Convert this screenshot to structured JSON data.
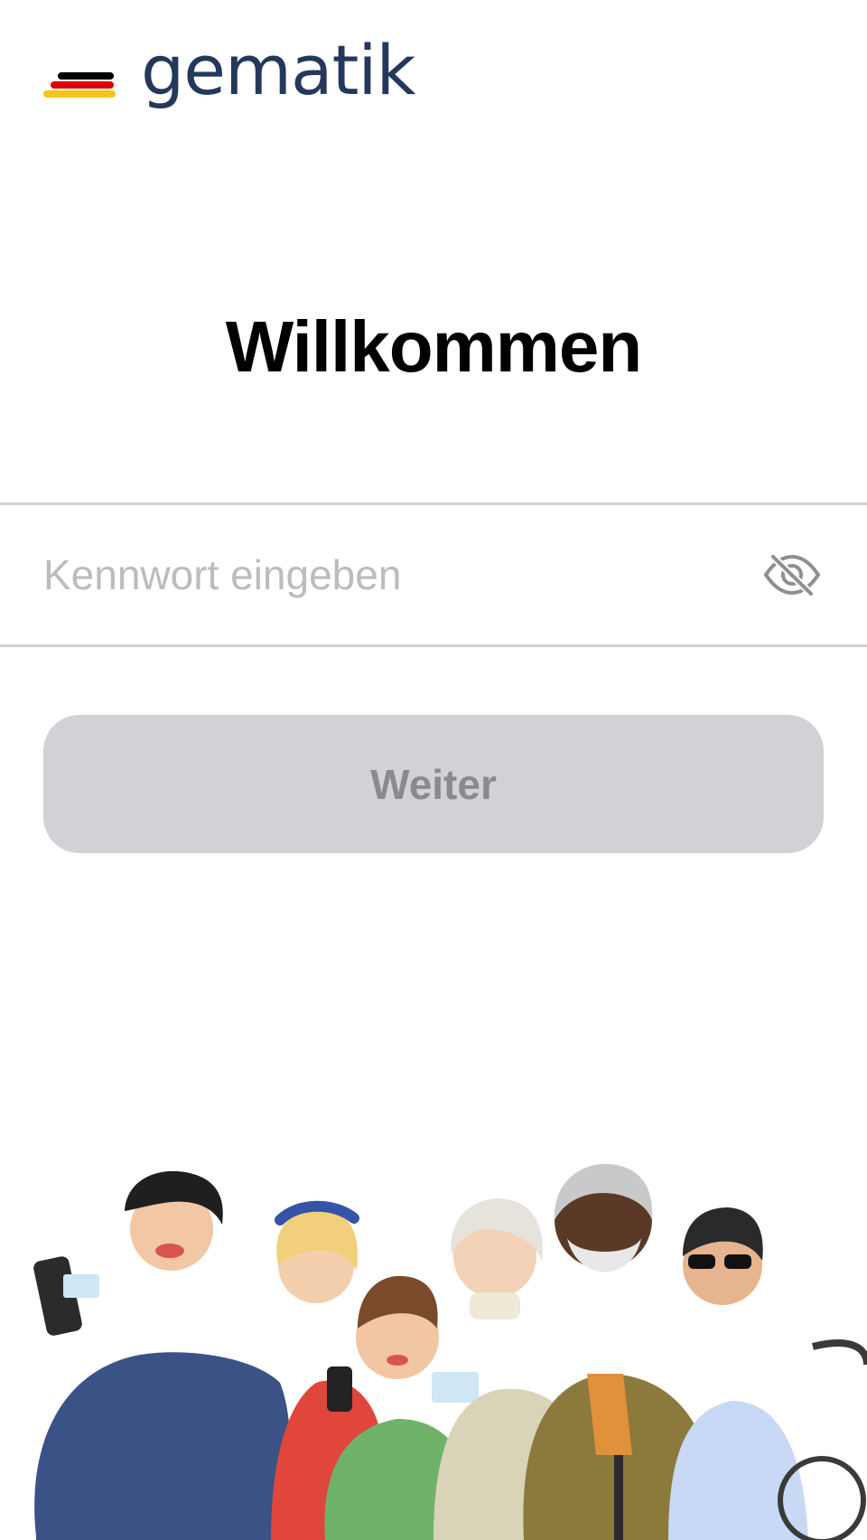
{
  "brand": {
    "name": "gematik",
    "text_color": "#24385b",
    "stripe_colors": [
      "#000000",
      "#dd0000",
      "#f5c518"
    ]
  },
  "screen": {
    "title": "Willkommen"
  },
  "password_field": {
    "placeholder": "Kennwort eingeben",
    "value": "",
    "visibility_icon": "eye-slash-icon"
  },
  "continue_button": {
    "label": "Weiter",
    "enabled": false
  },
  "illustration": {
    "description_icon": "group-of-people-illustration"
  }
}
